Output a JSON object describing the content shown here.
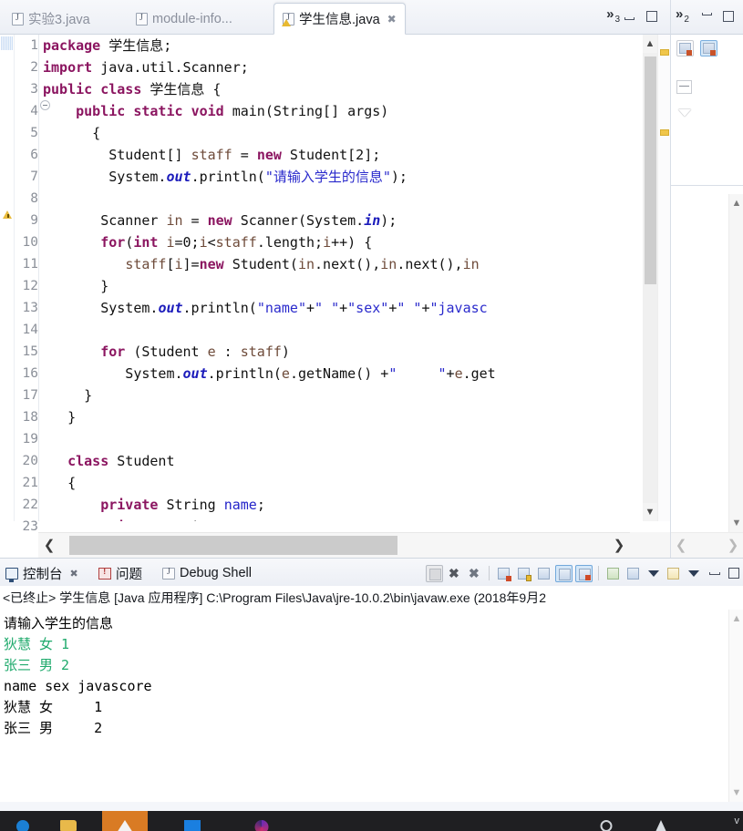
{
  "editor": {
    "tabs": [
      {
        "label": "实验3.java",
        "active": false,
        "closable": false,
        "icon": "java-file-icon",
        "warning": false
      },
      {
        "label": "module-info...",
        "active": false,
        "closable": false,
        "icon": "java-file-icon",
        "warning": false
      },
      {
        "label": "学生信息.java",
        "active": true,
        "closable": true,
        "icon": "java-file-icon",
        "warning": true
      }
    ],
    "overflow_label": "»",
    "overflow_count": "3",
    "minimize_label": "最小化",
    "maximize_label": "最大化",
    "lines": [
      {
        "n": "1",
        "fold": false,
        "warn": false
      },
      {
        "n": "2",
        "fold": false,
        "warn": false
      },
      {
        "n": "3",
        "fold": false,
        "warn": false
      },
      {
        "n": "4",
        "fold": true,
        "warn": false
      },
      {
        "n": "5",
        "fold": false,
        "warn": false
      },
      {
        "n": "6",
        "fold": false,
        "warn": false
      },
      {
        "n": "7",
        "fold": false,
        "warn": false
      },
      {
        "n": "8",
        "fold": false,
        "warn": false
      },
      {
        "n": "9",
        "fold": false,
        "warn": true
      },
      {
        "n": "10",
        "fold": false,
        "warn": false
      },
      {
        "n": "11",
        "fold": false,
        "warn": false
      },
      {
        "n": "12",
        "fold": false,
        "warn": false
      },
      {
        "n": "13",
        "fold": false,
        "warn": false
      },
      {
        "n": "14",
        "fold": false,
        "warn": false
      },
      {
        "n": "15",
        "fold": false,
        "warn": false
      },
      {
        "n": "16",
        "fold": false,
        "warn": false
      },
      {
        "n": "17",
        "fold": false,
        "warn": false
      },
      {
        "n": "18",
        "fold": false,
        "warn": false
      },
      {
        "n": "19",
        "fold": false,
        "warn": false
      },
      {
        "n": "20",
        "fold": false,
        "warn": false
      },
      {
        "n": "21",
        "fold": false,
        "warn": false
      },
      {
        "n": "22",
        "fold": false,
        "warn": false
      },
      {
        "n": "23",
        "fold": false,
        "warn": false
      }
    ],
    "source_plain": [
      "package 学生信息;",
      "import java.util.Scanner;",
      "public class 学生信息 {",
      "    public static void main(String[] args)",
      "      {",
      "        Student[] staff = new Student[2];",
      "        System.out.println(\"请输入学生的信息\");",
      "",
      "       Scanner in = new Scanner(System.in);",
      "       for(int i=0;i<staff.length;i++) {",
      "          staff[i]=new Student(in.next(),in.next(),in",
      "       }",
      "       System.out.println(\"name\"+\" \"+\"sex\"+\" \"+\"javasc",
      "",
      "       for (Student e : staff)",
      "          System.out.println(e.getName() +\"     \"+e.get",
      "     }",
      "   }",
      "",
      "   class Student",
      "   {",
      "       private String name;",
      "       private String sex;"
    ]
  },
  "outline_panel": {
    "overflow_label": "»",
    "overflow_count": "2",
    "minimize_label": "最小化",
    "maximize_label": "最大化",
    "tools": [
      {
        "name": "sort-toggle",
        "active": false
      },
      {
        "name": "hide-fields-toggle",
        "active": true
      },
      {
        "name": "collapse-all",
        "active": false
      },
      {
        "name": "view-menu",
        "active": false
      }
    ]
  },
  "console": {
    "tabs": [
      {
        "label": "控制台",
        "icon": "console-icon",
        "active": true,
        "closable": true
      },
      {
        "label": "问题",
        "icon": "problems-icon",
        "active": false,
        "closable": false
      },
      {
        "label": "Debug Shell",
        "icon": "debug-shell-icon",
        "active": false,
        "closable": false
      }
    ],
    "toolbar": [
      {
        "name": "terminate-icon",
        "enabled": false
      },
      {
        "name": "remove-launch-icon",
        "enabled": true
      },
      {
        "name": "remove-all-terminated-icon",
        "enabled": true
      },
      {
        "name": "clear-console-icon",
        "enabled": true
      },
      {
        "name": "scroll-lock-icon",
        "enabled": true
      },
      {
        "name": "word-wrap-icon",
        "enabled": true
      },
      {
        "name": "show-console-on-output-icon",
        "enabled": true,
        "toggled": true
      },
      {
        "name": "show-console-on-error-icon",
        "enabled": true,
        "toggled": true
      },
      {
        "name": "pin-console-icon",
        "enabled": true
      },
      {
        "name": "display-selected-console-icon",
        "enabled": true
      },
      {
        "name": "display-selected-dropdown-icon",
        "enabled": true
      },
      {
        "name": "open-console-icon",
        "enabled": true
      },
      {
        "name": "open-console-dropdown-icon",
        "enabled": true
      }
    ],
    "status_line": "<已终止> 学生信息 [Java 应用程序] C:\\Program Files\\Java\\jre-10.0.2\\bin\\javaw.exe  (2018年9月2",
    "output": [
      {
        "text": "请输入学生的信息",
        "type": "output"
      },
      {
        "text": "狄慧 女 1",
        "type": "input"
      },
      {
        "text": "张三 男 2",
        "type": "input"
      },
      {
        "text": "name sex javascore",
        "type": "output"
      },
      {
        "text": "狄慧 女     1",
        "type": "output"
      },
      {
        "text": "张三 男     2",
        "type": "output"
      }
    ]
  },
  "taskbar": {
    "items": [
      {
        "name": "start-button",
        "icon": "start-icon",
        "highlighted": false
      },
      {
        "name": "file-explorer",
        "icon": "folder-icon",
        "highlighted": false
      },
      {
        "name": "eclipse-app",
        "icon": "eclipse-icon",
        "highlighted": true
      },
      {
        "name": "window-app",
        "icon": "blue-window-icon",
        "highlighted": false
      },
      {
        "name": "media-app",
        "icon": "circle-icon",
        "highlighted": false
      },
      {
        "name": "tray-app-1",
        "icon": "ring-icon",
        "highlighted": false
      },
      {
        "name": "tray-app-2",
        "icon": "droplet-icon",
        "highlighted": false
      }
    ],
    "tray_chevron": "v"
  },
  "colors": {
    "keyword": "#8b1560",
    "string": "#2a2acc",
    "field": "#2323c9",
    "local": "#6e4b3a",
    "static_field": "#1b1bbb",
    "console_input": "#1faa6c",
    "warning": "#e8b931",
    "accent": "#d4e7f8"
  }
}
